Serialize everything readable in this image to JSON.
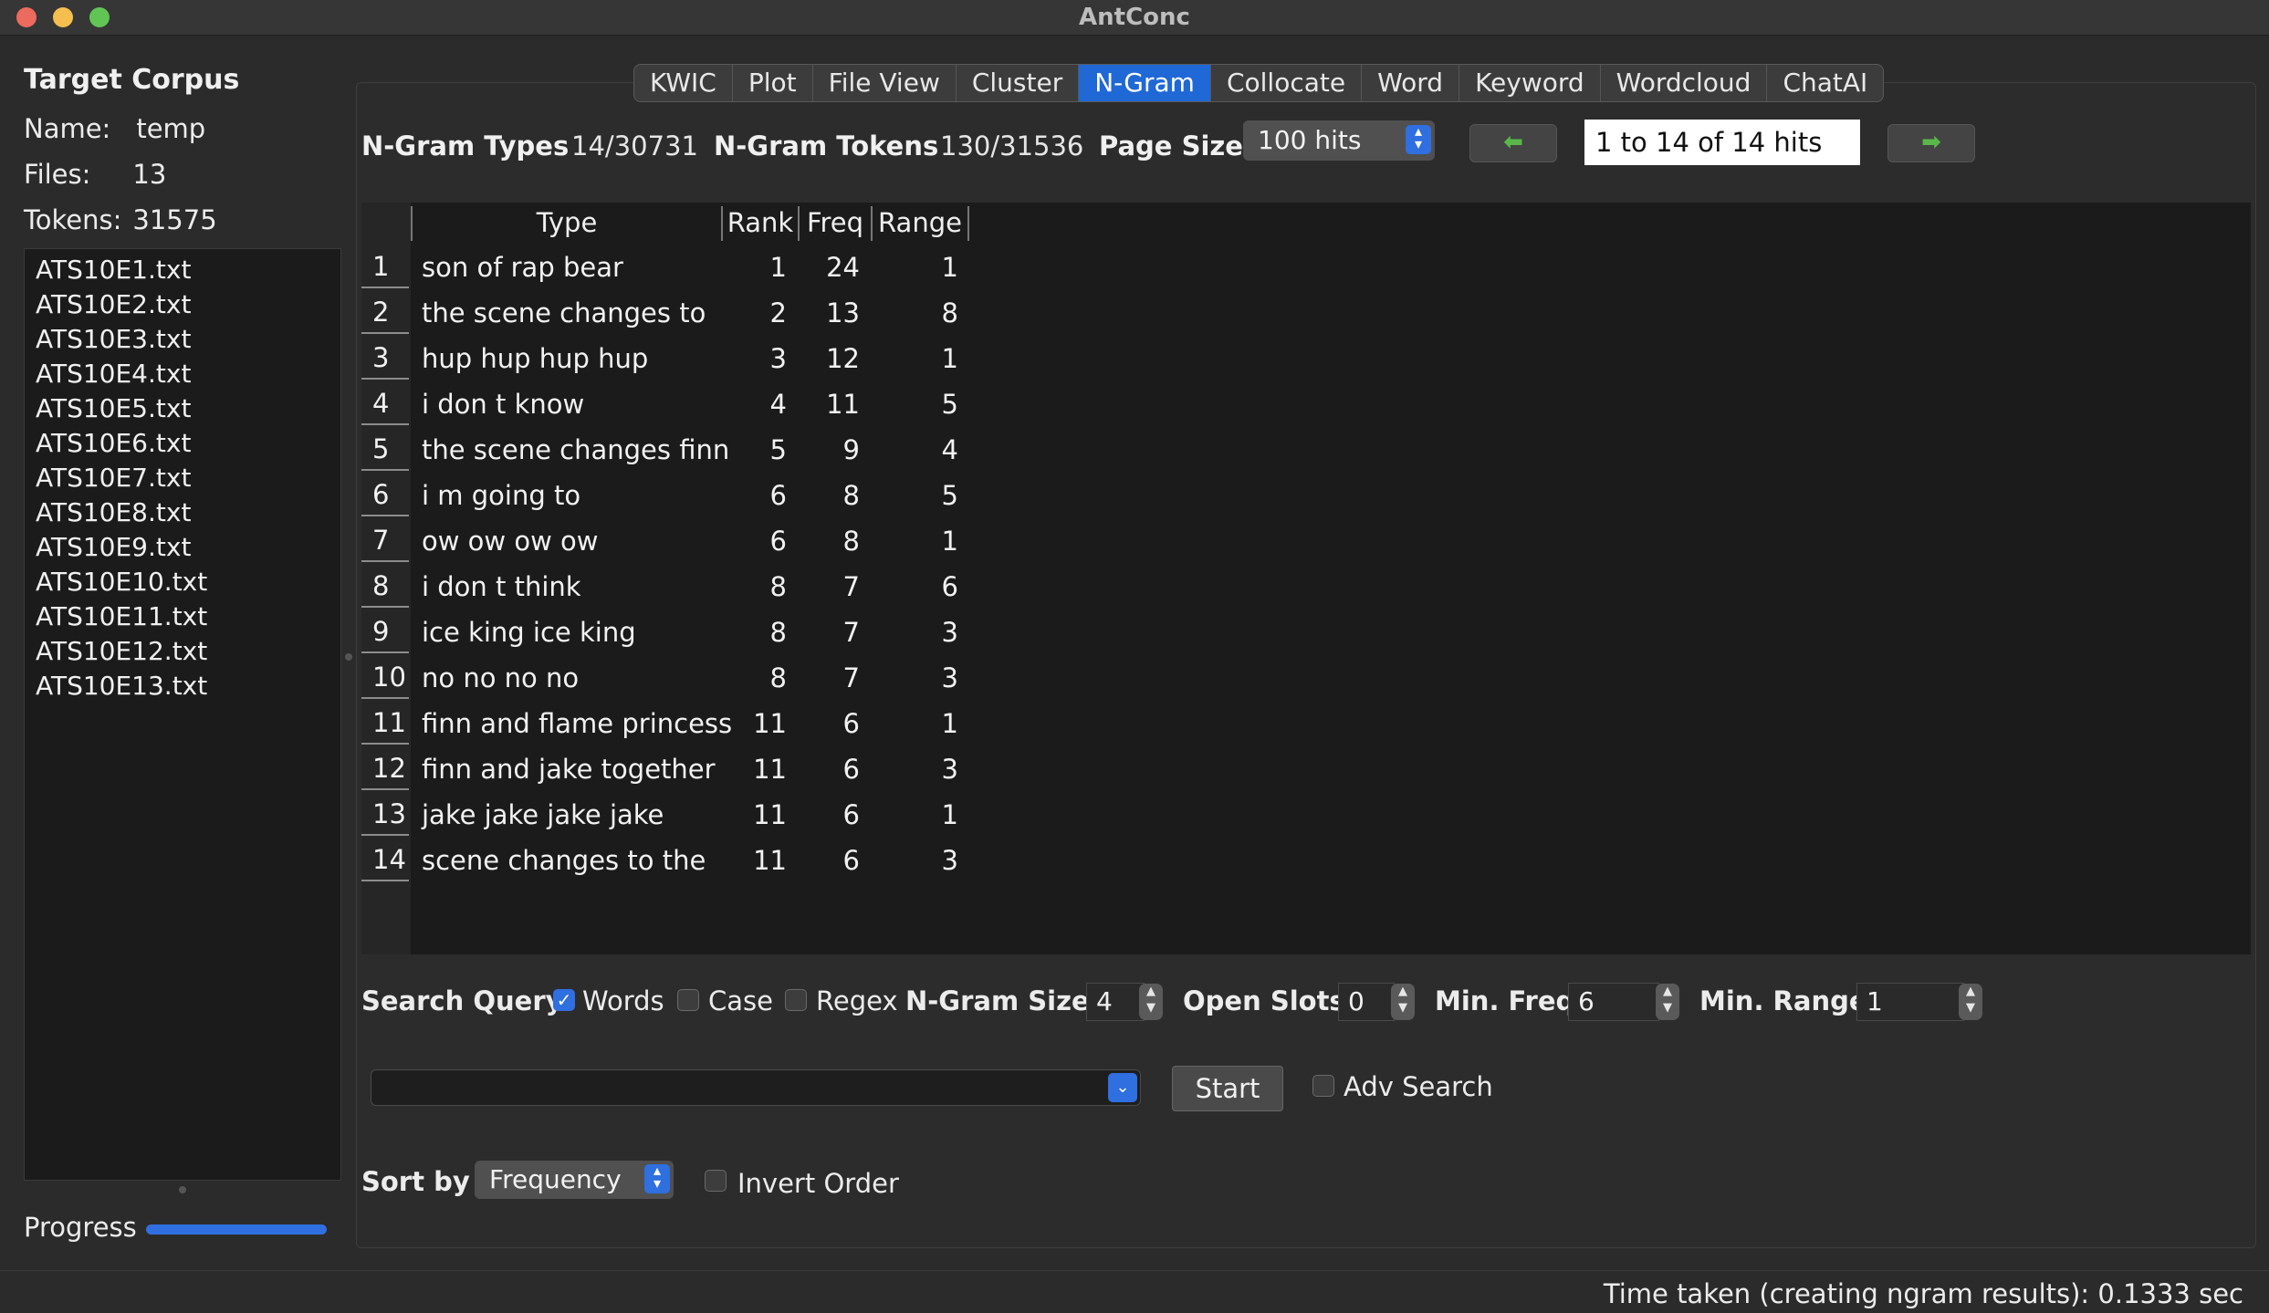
{
  "window": {
    "title": "AntConc"
  },
  "left_panel": {
    "title": "Target Corpus",
    "name_label": "Name:",
    "name_value": "temp",
    "files_label": "Files:",
    "files_value": "13",
    "tokens_label": "Tokens:",
    "tokens_value": "31575",
    "files": [
      "ATS10E1.txt",
      "ATS10E2.txt",
      "ATS10E3.txt",
      "ATS10E4.txt",
      "ATS10E5.txt",
      "ATS10E6.txt",
      "ATS10E7.txt",
      "ATS10E8.txt",
      "ATS10E9.txt",
      "ATS10E10.txt",
      "ATS10E11.txt",
      "ATS10E12.txt",
      "ATS10E13.txt"
    ],
    "progress_label": "Progress",
    "progress_value": 1.0
  },
  "tabs": [
    {
      "label": "KWIC"
    },
    {
      "label": "Plot"
    },
    {
      "label": "File View"
    },
    {
      "label": "Cluster"
    },
    {
      "label": "N-Gram",
      "active": true
    },
    {
      "label": "Collocate"
    },
    {
      "label": "Word"
    },
    {
      "label": "Keyword"
    },
    {
      "label": "Wordcloud"
    },
    {
      "label": "ChatAI"
    }
  ],
  "stats": {
    "types_label": "N-Gram Types",
    "types_value": "14/30731",
    "tokens_label": "N-Gram Tokens",
    "tokens_value": "130/31536",
    "page_size_label": "Page Size",
    "page_size_value": "100 hits",
    "hits_text": "1 to 14 of 14 hits"
  },
  "icons": {
    "prev": "arrow-left-icon",
    "next": "arrow-right-icon",
    "chevron": "chevron-updown-icon"
  },
  "table": {
    "headers": {
      "type": "Type",
      "rank": "Rank",
      "freq": "Freq",
      "range": "Range"
    },
    "rows": [
      {
        "num": "1",
        "type": "son of rap bear",
        "rank": "1",
        "freq": "24",
        "range": "1"
      },
      {
        "num": "2",
        "type": "the scene changes to",
        "rank": "2",
        "freq": "13",
        "range": "8"
      },
      {
        "num": "3",
        "type": "hup hup hup hup",
        "rank": "3",
        "freq": "12",
        "range": "1"
      },
      {
        "num": "4",
        "type": "i don t know",
        "rank": "4",
        "freq": "11",
        "range": "5"
      },
      {
        "num": "5",
        "type": "the scene changes finn",
        "rank": "5",
        "freq": "9",
        "range": "4"
      },
      {
        "num": "6",
        "type": "i m going to",
        "rank": "6",
        "freq": "8",
        "range": "5"
      },
      {
        "num": "7",
        "type": "ow ow ow ow",
        "rank": "6",
        "freq": "8",
        "range": "1"
      },
      {
        "num": "8",
        "type": "i don t think",
        "rank": "8",
        "freq": "7",
        "range": "6"
      },
      {
        "num": "9",
        "type": "ice king ice king",
        "rank": "8",
        "freq": "7",
        "range": "3"
      },
      {
        "num": "10",
        "type": "no no no no",
        "rank": "8",
        "freq": "7",
        "range": "3"
      },
      {
        "num": "11",
        "type": "finn and flame princess",
        "rank": "11",
        "freq": "6",
        "range": "1"
      },
      {
        "num": "12",
        "type": "finn and jake together",
        "rank": "11",
        "freq": "6",
        "range": "3"
      },
      {
        "num": "13",
        "type": "jake jake jake jake",
        "rank": "11",
        "freq": "6",
        "range": "1"
      },
      {
        "num": "14",
        "type": "scene changes to the",
        "rank": "11",
        "freq": "6",
        "range": "3"
      }
    ]
  },
  "search": {
    "label": "Search Query",
    "words_label": "Words",
    "words_checked": true,
    "case_label": "Case",
    "case_checked": false,
    "regex_label": "Regex",
    "regex_checked": false,
    "ngram_size_label": "N-Gram Size",
    "ngram_size_value": "4",
    "open_slots_label": "Open Slots",
    "open_slots_value": "0",
    "min_freq_label": "Min. Freq",
    "min_freq_value": "6",
    "min_range_label": "Min. Range",
    "min_range_value": "1",
    "query_value": "",
    "start_label": "Start",
    "adv_search_label": "Adv Search",
    "adv_search_checked": false
  },
  "sort": {
    "label": "Sort by",
    "value": "Frequency",
    "invert_label": "Invert Order",
    "invert_checked": false
  },
  "status": {
    "text": "Time taken (creating ngram results):  0.1333 sec"
  },
  "colors": {
    "accent": "#2f6fe0",
    "background": "#2b2b2b",
    "table_bg": "#1b1b1b"
  }
}
